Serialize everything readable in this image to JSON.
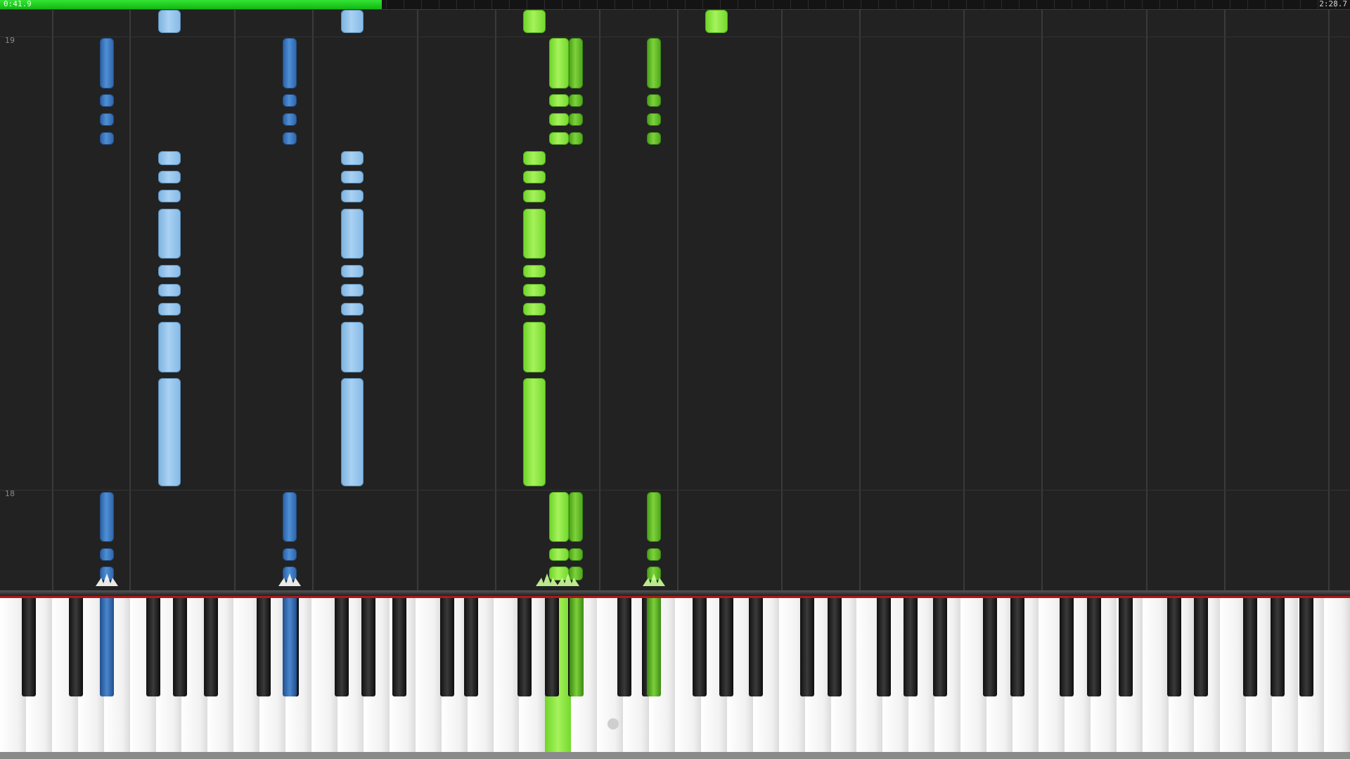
{
  "player": {
    "time_elapsed": "0:41.9",
    "time_total": "2:28.7",
    "progress": 0.283,
    "progress_color": "#22cc22"
  },
  "roll": {
    "measures": [
      "19",
      "18"
    ],
    "background": "#222222"
  },
  "colors": {
    "left_hand": "#a9d1f3",
    "left_hand_dark": "#3f7fc6",
    "right_hand": "#a6f25c",
    "right_hand_dark": "#6cc22e"
  },
  "keyboard": {
    "active_keys": [
      "blue-black",
      "blue-black",
      "green-white",
      "green-black",
      "green-black"
    ]
  }
}
